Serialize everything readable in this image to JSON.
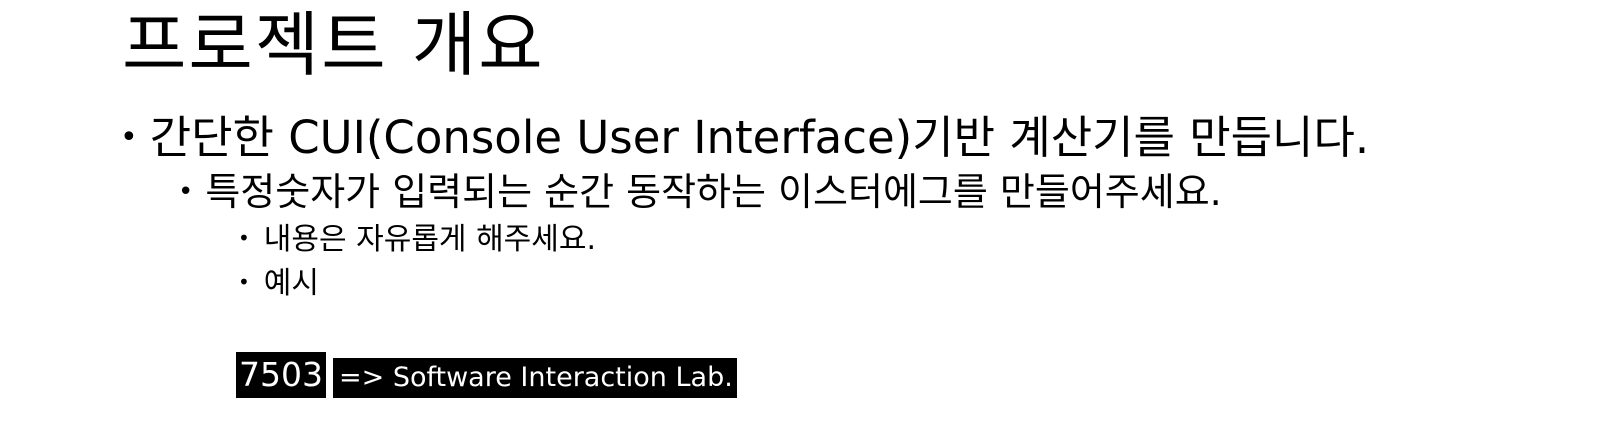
{
  "slide": {
    "title": "프로젝트 개요",
    "bullet_symbol": "•",
    "bullets": [
      {
        "level": 1,
        "text": "간단한 CUI(Console User Interface)기반 계산기를 만듭니다."
      },
      {
        "level": 2,
        "text": "특정숫자가 입력되는 순간 동작하는 이스터에그를 만들어주세요."
      },
      {
        "level": 3,
        "text": "내용은 자유롭게 해주세요."
      },
      {
        "level": 3,
        "text": "예시"
      }
    ],
    "example": {
      "number": "7503",
      "result": "=> Software Interaction Lab."
    }
  }
}
